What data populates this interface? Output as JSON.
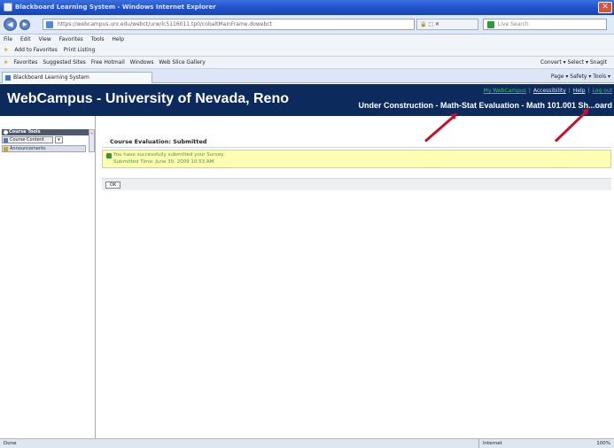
{
  "window": {
    "title": "Blackboard Learning System - Windows Internet Explorer",
    "close_glyph": "✕"
  },
  "addressbar": {
    "back_glyph": "◀",
    "forward_glyph": "▶",
    "url": "https://webcampus.unr.edu/webct/urw/lc5116011.tp0/cobaltMainFrame.dowebct",
    "tools_text": "🔒 ⬚ ✕",
    "search_placeholder": "Live Search"
  },
  "menu": {
    "items": [
      "File",
      "Edit",
      "View",
      "Favorites",
      "Tools",
      "Help"
    ]
  },
  "links": {
    "items": [
      "Add to Favorites",
      "Print Listing"
    ]
  },
  "favorites": {
    "items": [
      "Favorites",
      "Suggested Sites",
      "Free Hotmail",
      "Windows",
      "Web Slice Gallery"
    ],
    "right_tools": "Convert ▾  Select ▾  Snagit"
  },
  "tab": {
    "label": "Blackboard Learning System",
    "command_bar": "Page ▾  Safety ▾  Tools ▾"
  },
  "banner": {
    "brand": "WebCampus - University of Nevada, Reno",
    "links": [
      "My WebCampus",
      "Accessibility",
      "Help",
      "Log out"
    ],
    "breadcrumb": "Under Construction - Math-Stat Evaluation - Math 101.001 Sh...oard"
  },
  "sidebar": {
    "header": "Course Tools",
    "tab_label": "Course Content",
    "tab_extra": "▾",
    "item": "Announcements",
    "handle": "«"
  },
  "main": {
    "title": "Course Evaluation: Submitted",
    "notice_line1": "You have successfully submitted your Survey.",
    "notice_line2": "Submitted Time: June 30, 2009 10:53 AM",
    "ok_button": "OK"
  },
  "statusbar": {
    "status": "Done",
    "zone": "Internet",
    "zoom": "100%"
  },
  "colors": {
    "banner_bg": "#0d2a5c",
    "notice_bg": "#ffffb3",
    "arrow": "#c8102e",
    "link_green": "#38c35a"
  }
}
